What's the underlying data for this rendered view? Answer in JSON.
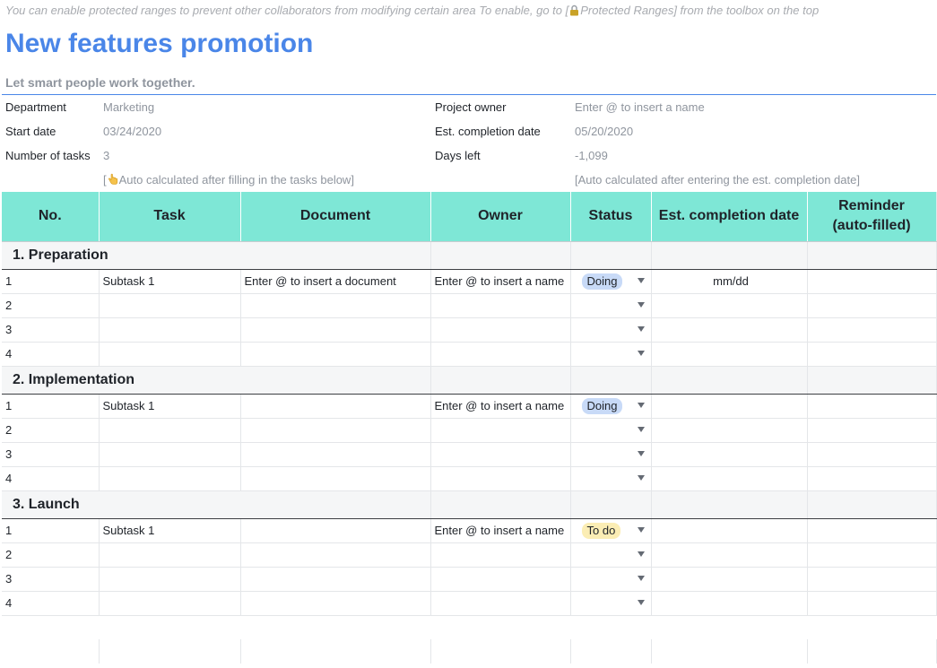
{
  "hint": {
    "before": "You can enable protected ranges to prevent other collaborators from modifying certain area To enable, go to [",
    "after": "Protected Ranges] from the toolbox on the top",
    "icon": "lock-icon"
  },
  "title": "New features promotion",
  "subtitle": "Let smart people work together.",
  "info": {
    "department_label": "Department",
    "department_value": "Marketing",
    "start_label": "Start date",
    "start_value": "03/24/2020",
    "tasks_label": "Number of tasks",
    "tasks_value": "3",
    "tasks_note_prefix": "[",
    "tasks_note_icon": "pointing-hand-icon",
    "tasks_note": "Auto calculated after filling in the tasks below]",
    "owner_label": "Project owner",
    "owner_value": "Enter @ to insert a name",
    "completion_label": "Est. completion date",
    "completion_value": "05/20/2020",
    "days_label": "Days left",
    "days_value": "-1,099",
    "days_note": "[Auto calculated after entering the est. completion date]"
  },
  "columns": {
    "no": "No.",
    "task": "Task",
    "document": "Document",
    "owner": "Owner",
    "status": "Status",
    "completion": "Est. completion date",
    "reminder_line1": "Reminder",
    "reminder_line2": "(auto-filled)"
  },
  "sections": [
    {
      "title": "1. Preparation",
      "first_row": {
        "no": "1",
        "task": "Subtask 1",
        "document": "Enter @ to insert a document",
        "owner": "Enter @ to insert a name",
        "status": "Doing",
        "completion": "mm/dd"
      },
      "other_rows": [
        "2",
        "3",
        "4"
      ]
    },
    {
      "title": "2. Implementation",
      "first_row": {
        "no": "1",
        "task": "Subtask 1",
        "owner": "Enter @ to insert a name",
        "status": "Doing"
      },
      "other_rows": [
        "2",
        "3",
        "4"
      ]
    },
    {
      "title": "3. Launch",
      "first_row": {
        "no": "1",
        "task": "Subtask 1",
        "owner": "Enter @ to insert a name",
        "status": "To do"
      },
      "other_rows": [
        "2",
        "3",
        "4"
      ]
    }
  ],
  "colors": {
    "title": "#4a86e8",
    "header_bg": "#7ee7d6",
    "doing_pill": "#c8daf7",
    "todo_pill": "#fbedb4"
  }
}
